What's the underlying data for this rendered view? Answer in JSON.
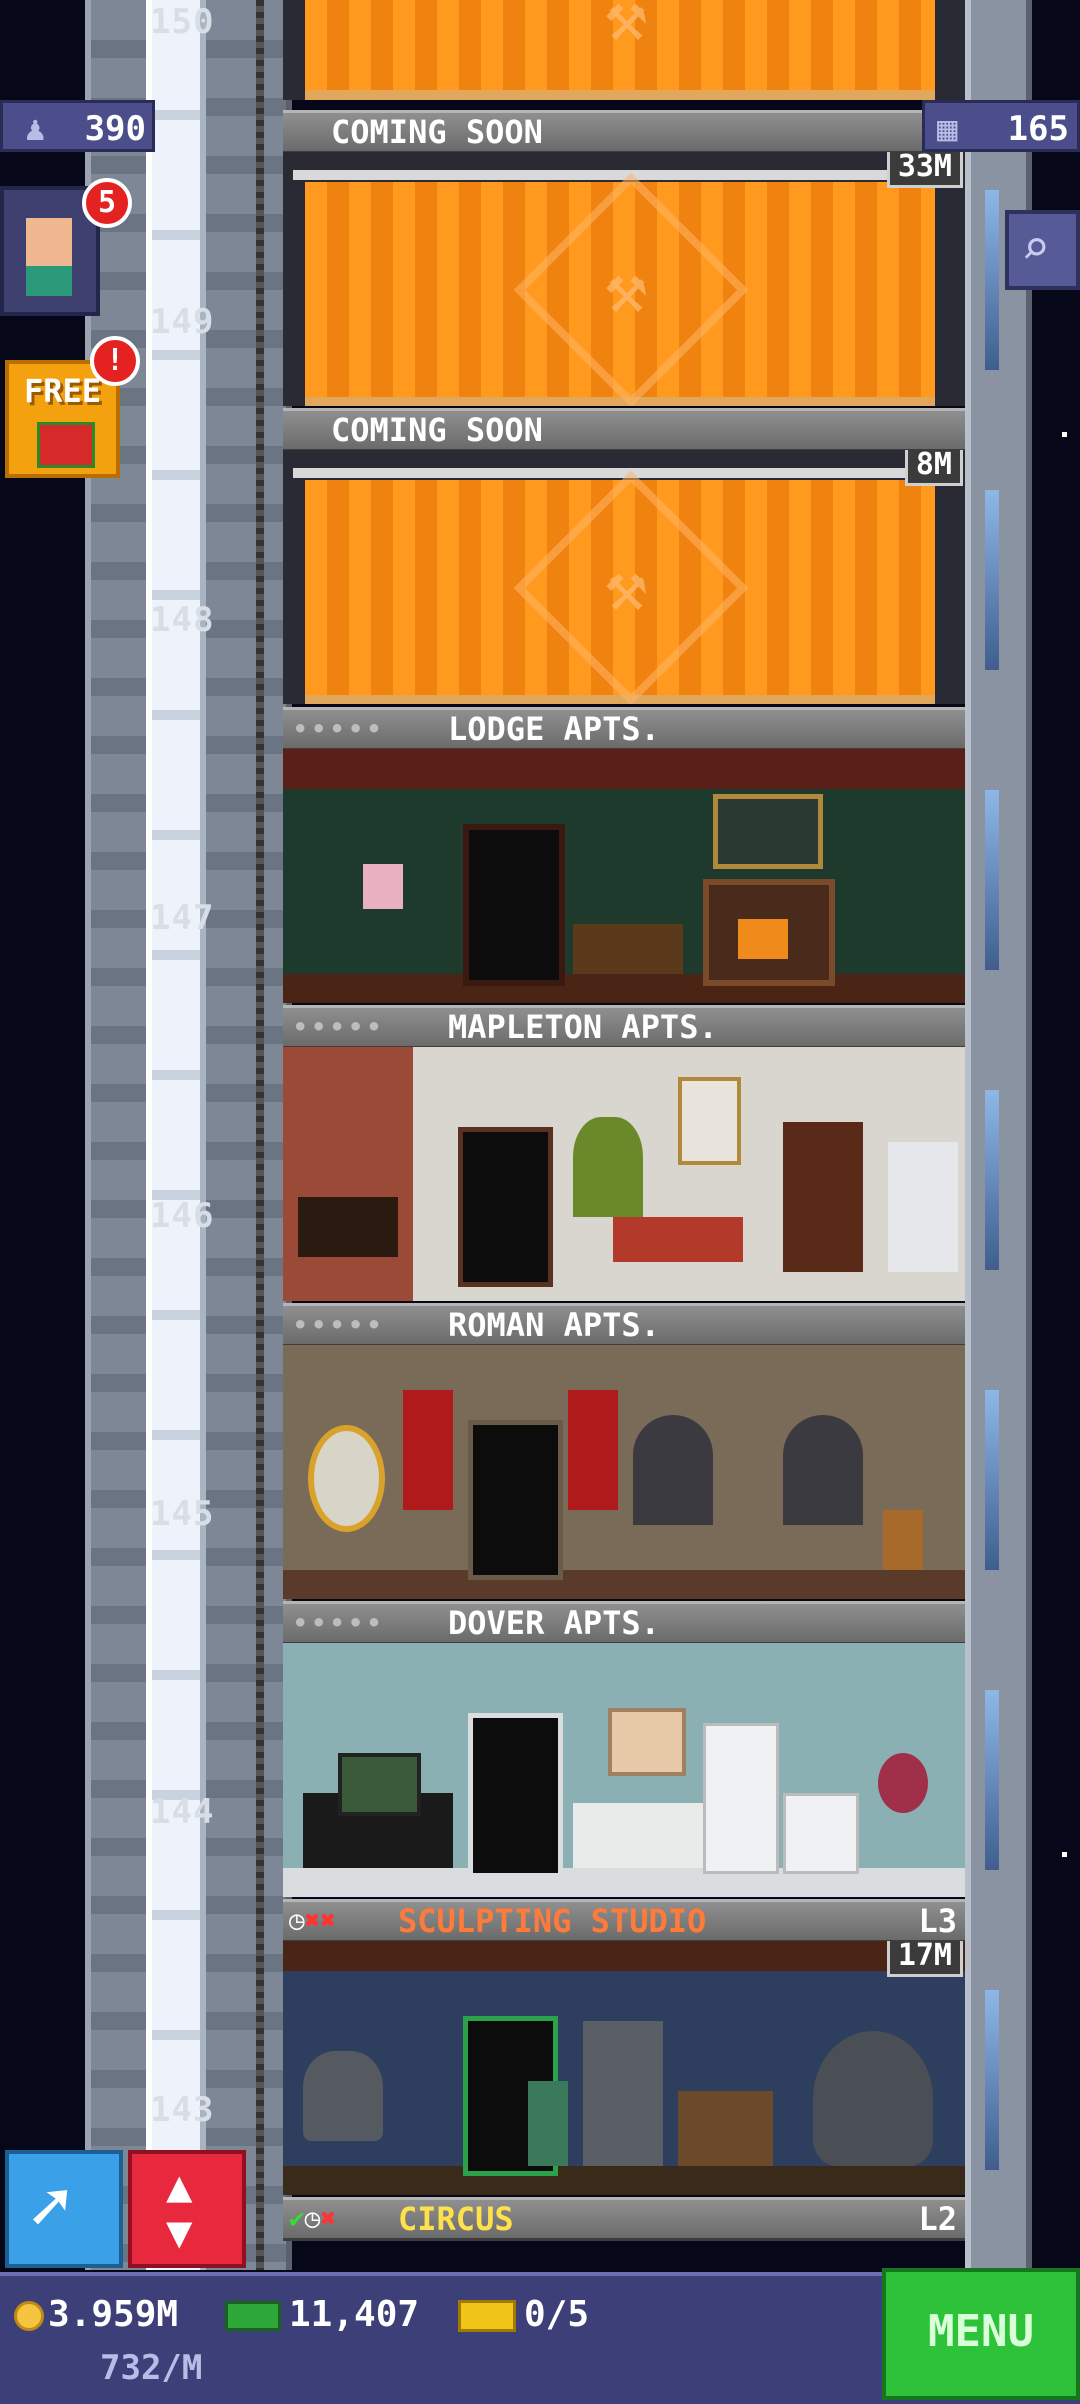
{
  "hud": {
    "population": "390",
    "tower_bux": "165",
    "avatar_notification": "5",
    "free_label": "FREE",
    "free_notification": "!"
  },
  "shaft": {
    "floor_numbers": [
      "150",
      "149",
      "148",
      "147",
      "146",
      "145",
      "144",
      "143"
    ]
  },
  "floors": [
    {
      "name": "COMING SOON",
      "price": "33M",
      "status": "construction"
    },
    {
      "name": "COMING SOON",
      "price": "8M",
      "status": "construction"
    },
    {
      "name": "LODGE APTS.",
      "dots": "•••••"
    },
    {
      "name": "MAPLETON APTS.",
      "dots": "•••••"
    },
    {
      "name": "ROMAN APTS.",
      "dots": "•••••"
    },
    {
      "name": "DOVER APTS.",
      "dots": "•••••"
    },
    {
      "name": "SCULPTING STUDIO",
      "level": "L3",
      "price": "17M",
      "name_color": "#ff7b3a"
    },
    {
      "name": "CIRCUS",
      "level": "L2",
      "name_color": "#ffe14a"
    }
  ],
  "bottom_bar": {
    "coins": "3.959M",
    "coins_per_min": "732/M",
    "bux": "11,407",
    "tickets": "0/5",
    "menu_label": "MENU"
  },
  "colors": {
    "construction_orange": "#ff9a1f",
    "hud_purple": "#4b4e8a",
    "menu_green": "#2ec23a",
    "notification_red": "#e52222"
  }
}
